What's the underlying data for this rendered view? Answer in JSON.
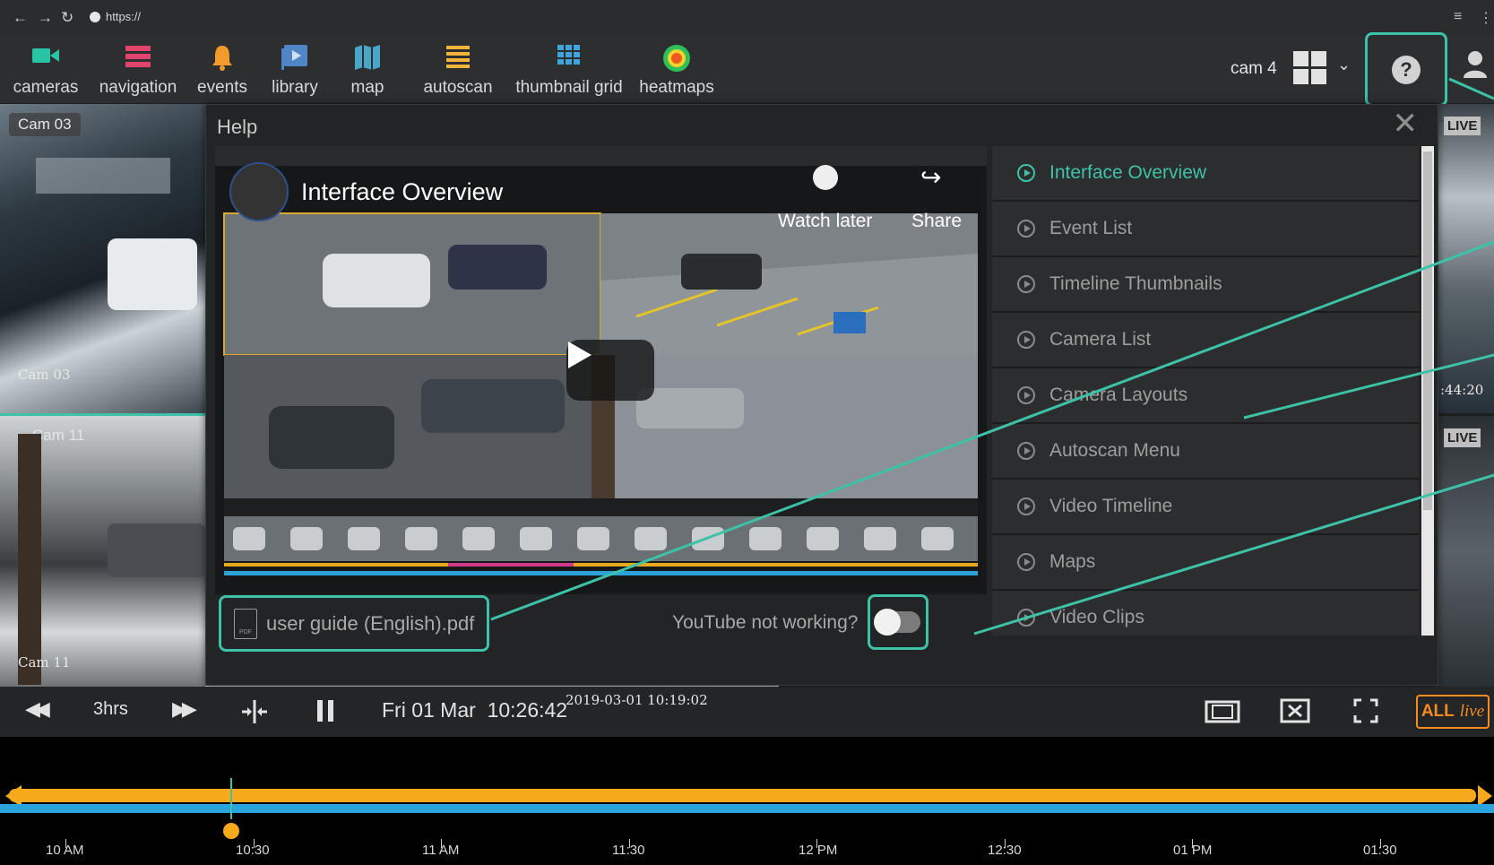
{
  "browser": {
    "url": "https://"
  },
  "toolbar": {
    "items": [
      {
        "label": "cameras",
        "icon": "video-camera-icon"
      },
      {
        "label": "navigation",
        "icon": "list-icon"
      },
      {
        "label": "events",
        "icon": "bell-icon"
      },
      {
        "label": "library",
        "icon": "library-icon"
      },
      {
        "label": "map",
        "icon": "map-icon"
      },
      {
        "label": "autoscan",
        "icon": "autoscan-icon"
      },
      {
        "label": "thumbnail grid",
        "icon": "thumbnail-grid-icon"
      },
      {
        "label": "heatmaps",
        "icon": "heatmap-icon"
      }
    ],
    "cam_label": "cam 4",
    "help_symbol": "?"
  },
  "cameras": {
    "tile1_name": "Cam 03",
    "tile1_stamp": "Cam 03",
    "tile2_name": "Cam 11",
    "tile2_stamp": "Cam 11",
    "center_stamp": "2019-03-01 10:19:02",
    "live1": "LIVE",
    "live2": "LIVE",
    "right_time": ":44:20"
  },
  "help": {
    "title": "Help",
    "close": "✕",
    "video": {
      "title": "Interface Overview",
      "watch_later": "Watch later",
      "share": "Share"
    },
    "pdf_link": "user guide (English).pdf",
    "pdf_icon_text": "PDF",
    "youtube_label": "YouTube not working?",
    "menu": [
      {
        "label": "Interface Overview",
        "active": true
      },
      {
        "label": "Event List",
        "active": false
      },
      {
        "label": "Timeline Thumbnails",
        "active": false
      },
      {
        "label": "Camera List",
        "active": false
      },
      {
        "label": "Camera Layouts",
        "active": false
      },
      {
        "label": "Autoscan Menu",
        "active": false
      },
      {
        "label": "Video Timeline",
        "active": false
      },
      {
        "label": "Maps",
        "active": false
      },
      {
        "label": "Video Clips",
        "active": false
      }
    ]
  },
  "controls": {
    "rewind": "◀◀",
    "span": "3hrs",
    "forward": "▶▶",
    "datetime": "Fri 01 Mar  10:26:42",
    "all_live_all": "ALL",
    "all_live_live": "live"
  },
  "timeline": {
    "labels": [
      "10 AM",
      "10:30",
      "11 AM",
      "11:30",
      "12 PM",
      "12:30",
      "01 PM",
      "01:30"
    ]
  },
  "colors": {
    "accent": "#3ec2a7",
    "timeline_orange": "#f6a91a",
    "timeline_blue": "#29a4dc",
    "live_orange": "#f68b1f"
  }
}
